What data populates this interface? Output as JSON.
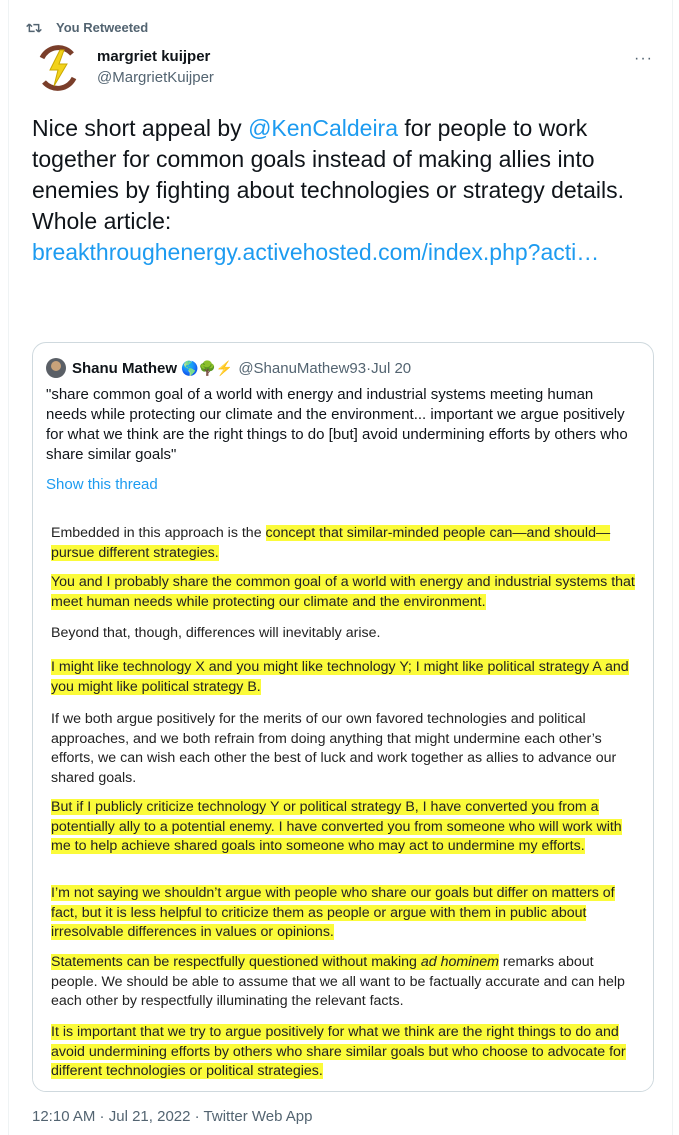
{
  "retweet": {
    "icon": "retweet-icon",
    "label": "You Retweeted"
  },
  "author": {
    "name": "margriet kuijper",
    "handle": "@MargrietKuijper",
    "menu": "···"
  },
  "tweet": {
    "part1": "Nice short appeal by ",
    "mention": "@KenCaldeira",
    "part2": " for people to work together for common goals instead of making allies into enemies by fighting about technologies or strategy details.",
    "part3": "Whole article:",
    "link": "breakthroughenergy.activehosted.com/index.php?acti…"
  },
  "quote": {
    "name": "Shanu Mathew",
    "emojis": "🌎🌳⚡",
    "handle": "@ShanuMathew93",
    "sep": " · ",
    "date": "Jul 20",
    "text": "\"share common goal of a world with energy and industrial systems meeting human needs while protecting our climate and the environment... important we argue positively for what we think are the right things to do [but] avoid undermining efforts by others who share similar goals\"",
    "show_thread": "Show this thread"
  },
  "article": {
    "p1a": "Embedded in this approach is the ",
    "p1b": "concept that similar-minded people can—and should—pursue different strategies.",
    "p2": "You and I probably share the common goal of a world with energy and industrial systems that meet human needs while protecting our climate and the environment.",
    "p3": "Beyond that, though, differences will inevitably arise.",
    "p4": "I might like technology X and you might like technology Y; I might like political strategy A and you might like political strategy B.",
    "p5": "If we both argue positively for the merits of our own favored technologies and political approaches, and we both refrain from doing anything that might undermine each other’s efforts, we can wish each other the best of luck and work together as allies to advance our shared goals.",
    "p6": "But if I publicly criticize technology Y or political strategy B, I have converted you from a potentially ally to a potential enemy. I have converted you from someone who will work with me to help achieve shared goals into someone who may act to undermine my efforts.",
    "p7": "I’m not saying we shouldn’t argue with people who share our goals but differ on matters of fact, but it is less helpful to criticize them as people or argue with them in public about irresolvable differences in values or opinions.",
    "p8a": "Statements can be respectfully questioned without making ",
    "p8b": "ad hominem",
    "p8c": " remarks about people. We should be able to assume that we all want to be factually accurate and can help each other by respectfully illuminating the relevant facts.",
    "p9": "It is important that we try to argue positively for what we think are the right things to do and avoid undermining efforts by others who share similar goals but who choose to advocate for different technologies or political strategies."
  },
  "footer": {
    "time": "12:10 AM",
    "sep": " · ",
    "date": "Jul 21, 2022",
    "sep2": " · ",
    "app": "Twitter Web App"
  },
  "colors": {
    "link": "#1d9bf0",
    "highlight": "#fbfb3a",
    "muted": "#536471"
  }
}
